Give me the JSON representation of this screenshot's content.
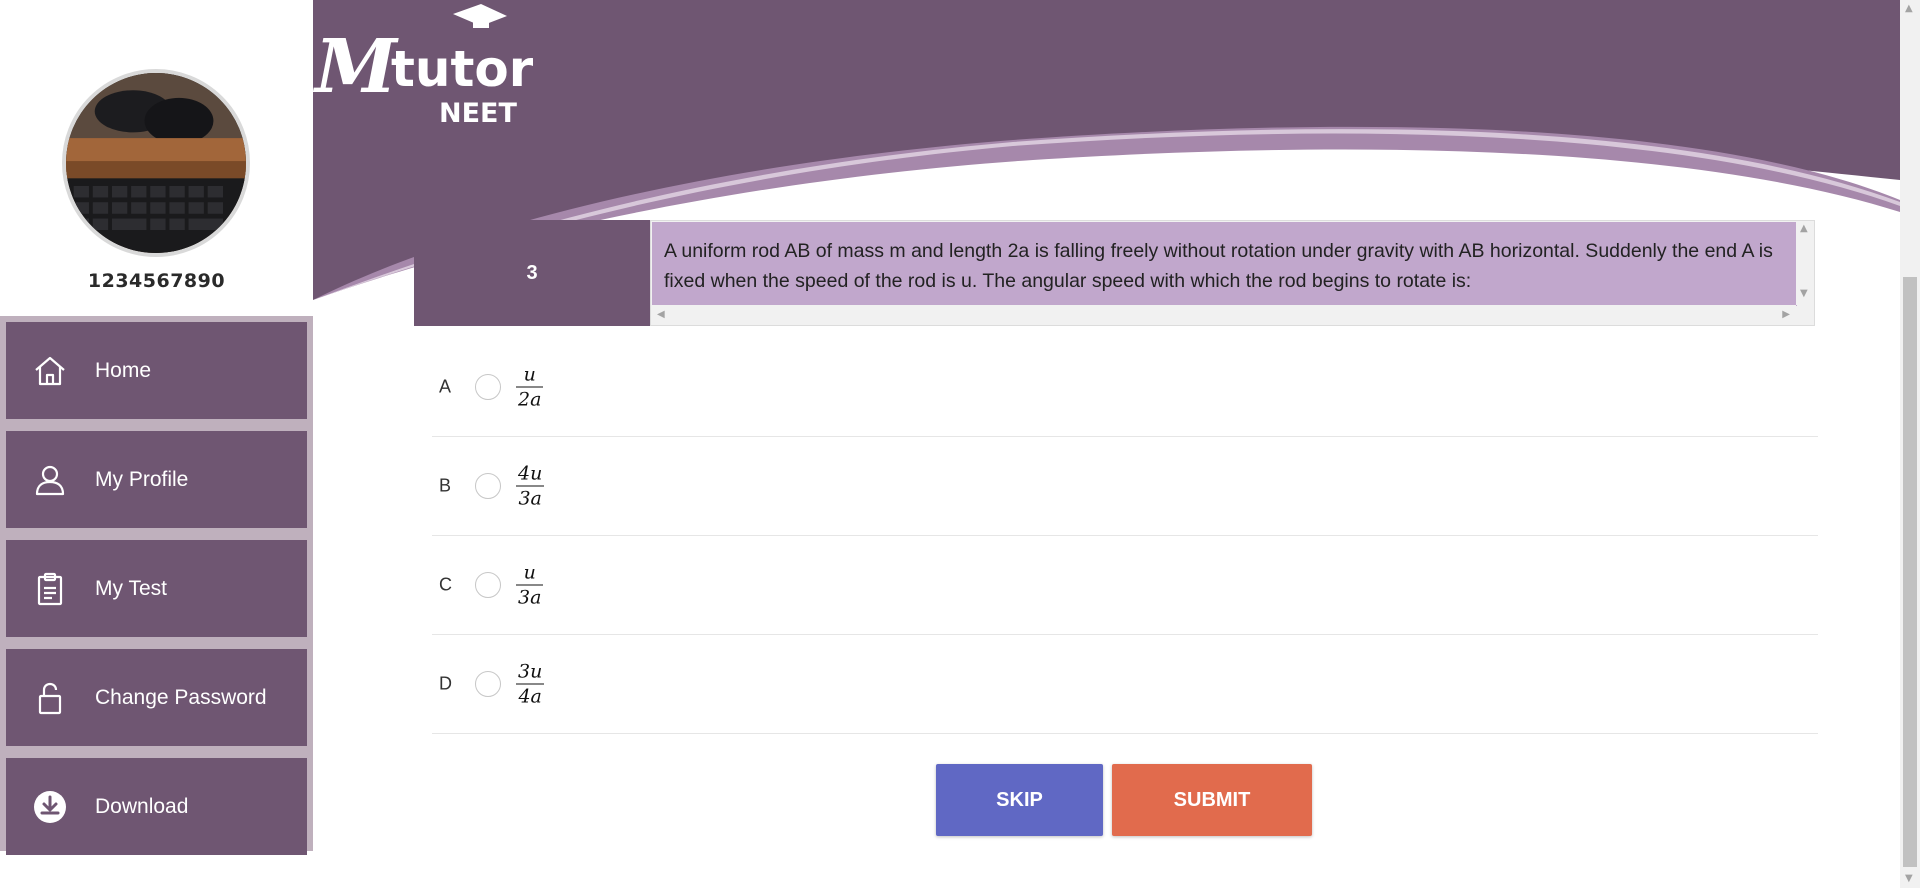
{
  "sidebar": {
    "user_id": "1234567890",
    "items": [
      {
        "label": "Home",
        "icon": "home-icon"
      },
      {
        "label": "My Profile",
        "icon": "user-icon"
      },
      {
        "label": "My Test",
        "icon": "clipboard-icon"
      },
      {
        "label": "Change Password",
        "icon": "lock-icon"
      },
      {
        "label": "Download",
        "icon": "download-icon"
      }
    ]
  },
  "header": {
    "logo_text": "Mtutor",
    "logo_subtext": "NEET"
  },
  "question": {
    "number": "3",
    "text": "A uniform rod AB of mass m and length 2a is falling freely without rotation under gravity with AB horizontal. Suddenly the end A is fixed when the speed of the rod is u. The angular speed with which the rod begins to rotate is:"
  },
  "options": [
    {
      "letter": "A",
      "numerator": "u",
      "denominator": "2a"
    },
    {
      "letter": "B",
      "numerator": "4u",
      "denominator": "3a"
    },
    {
      "letter": "C",
      "numerator": "u",
      "denominator": "3a"
    },
    {
      "letter": "D",
      "numerator": "3u",
      "denominator": "4a"
    }
  ],
  "actions": {
    "skip_label": "SKIP",
    "submit_label": "SUBMIT"
  },
  "colors": {
    "brand_purple": "#6f5672",
    "question_bg": "#c1a7cc",
    "skip": "#6068c4",
    "submit": "#e16b4d"
  }
}
